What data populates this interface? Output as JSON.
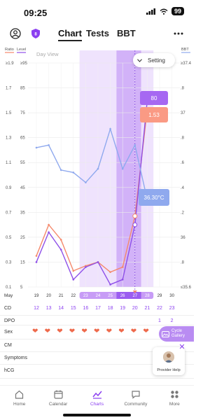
{
  "status_bar": {
    "time": "09:25",
    "battery": "99"
  },
  "header": {
    "tabs": [
      {
        "label": "Chart",
        "active": true
      },
      {
        "label": "Tests",
        "active": false
      },
      {
        "label": "BBT",
        "active": false
      }
    ],
    "more_icon": "more-icon",
    "profile_icon": "profile-icon",
    "shield_icon": "shield-icon"
  },
  "chart": {
    "left_header_ratio": "Ratio",
    "left_header_level": "Level",
    "right_header": "BBT",
    "day_view": "Day View",
    "setting_label": "Setting",
    "ratio_ticks": [
      "≥1.9",
      "1.7",
      "1.5",
      "1.3",
      "1.1",
      "0.9",
      "0.7",
      "0.5",
      "0.3",
      "0.1"
    ],
    "level_ticks": [
      "≥95",
      "85",
      "75",
      "65",
      "55",
      "45",
      "35",
      "25",
      "15",
      "5"
    ],
    "bbt_ticks": [
      "≥37.4",
      ".8",
      "37",
      ".8",
      ".6",
      ".4",
      ".2",
      "36",
      ".8",
      "≤35.6"
    ],
    "month_label": "May",
    "x_days": [
      "19",
      "20",
      "21",
      "22",
      "23",
      "24",
      "25",
      "26",
      "27",
      "28",
      "29",
      "30"
    ],
    "level_callout": "80",
    "ratio_callout": "1.53",
    "bbt_callout": "36.30°C",
    "colors": {
      "ratio": "#f5896c",
      "level": "#8e4fe8",
      "bbt": "#8fa9ee",
      "fertile_window": "#efe3fd",
      "peak_band": "#d2b2f8",
      "accent": "#8b3ff0"
    }
  },
  "chart_data": {
    "type": "line",
    "x": [
      "19",
      "20",
      "21",
      "22",
      "23",
      "24",
      "25",
      "26",
      "27",
      "28",
      "29",
      "30"
    ],
    "series": [
      {
        "name": "Ratio",
        "axis": "left",
        "values": [
          0.35,
          0.6,
          0.48,
          0.23,
          0.27,
          0.3,
          0.22,
          0.26,
          0.67,
          1.53,
          null,
          null
        ]
      },
      {
        "name": "Level",
        "axis": "left",
        "values": [
          15,
          27,
          20,
          8,
          13,
          15,
          6,
          8,
          30,
          80,
          null,
          null
        ]
      },
      {
        "name": "BBT",
        "axis": "right",
        "values": [
          36.72,
          36.74,
          36.54,
          36.52,
          36.44,
          36.55,
          36.87,
          36.55,
          36.74,
          36.3,
          null,
          null
        ]
      }
    ],
    "left_ratio_range": [
      0.1,
      1.9
    ],
    "left_level_range": [
      5,
      95
    ],
    "right_bbt_range": [
      35.6,
      37.4
    ],
    "grid": true,
    "fertile_window_days": [
      "23",
      "28"
    ],
    "peak_days": [
      "26",
      "27"
    ]
  },
  "rows": {
    "cd": {
      "label": "CD",
      "values": [
        "12",
        "13",
        "14",
        "15",
        "16",
        "17",
        "18",
        "19",
        "20",
        "21",
        "22",
        "23"
      ]
    },
    "dpo": {
      "label": "DPO",
      "values": [
        "",
        "",
        "",
        "",
        "",
        "",
        "",
        "",
        "",
        "",
        "1",
        "2"
      ]
    },
    "sex": {
      "label": "Sex",
      "days": [
        "19",
        "20",
        "21",
        "22",
        "23",
        "24",
        "25",
        "26",
        "27",
        "28"
      ]
    },
    "cm": {
      "label": "CM"
    },
    "symptoms": {
      "label": "Symptoms"
    },
    "hcg": {
      "label": "hCG"
    }
  },
  "cycle_gallery": {
    "label_1": "Cycle",
    "label_2": "Gallery"
  },
  "provider_help": {
    "label": "Provider Help"
  },
  "bottom_nav": [
    {
      "label": "Home",
      "icon": "home-icon",
      "active": false
    },
    {
      "label": "Calendar",
      "icon": "calendar-icon",
      "active": false
    },
    {
      "label": "Charts",
      "icon": "charts-icon",
      "active": true
    },
    {
      "label": "Community",
      "icon": "community-icon",
      "active": false
    },
    {
      "label": "More",
      "icon": "grid-icon",
      "active": false
    }
  ]
}
